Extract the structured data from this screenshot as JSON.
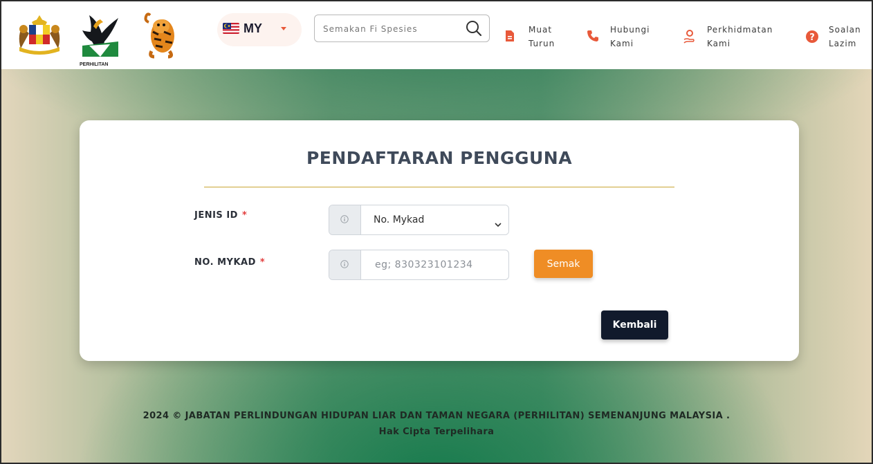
{
  "header": {
    "language": {
      "code": "MY"
    },
    "search": {
      "placeholder": "Semakan Fi Spesies"
    },
    "logos": {
      "perhilitan_label": "PERHILITAN"
    },
    "nav": [
      {
        "label": "Muat\nTurun",
        "icon": "file-download-icon",
        "color": "#e8593a"
      },
      {
        "label": "Hubungi\nKami",
        "icon": "phone-icon",
        "color": "#e8593a"
      },
      {
        "label": "Perkhidmatan\nKami",
        "icon": "service-hand-icon",
        "color": "#e8593a"
      },
      {
        "label": "Soalan\nLazim",
        "icon": "question-circle-icon",
        "color": "#e8593a"
      }
    ]
  },
  "form": {
    "title": "PENDAFTARAN PENGGUNA",
    "jenis_id": {
      "label": "JENIS ID",
      "selected": "No. Mykad"
    },
    "mykad": {
      "label": "NO. MYKAD",
      "placeholder": "eg; 830323101234"
    },
    "required_marker": "*",
    "semak_label": "Semak",
    "kembali_label": "Kembali"
  },
  "footer": {
    "line1": "2024 © JABATAN PERLINDUNGAN HIDUPAN LIAR DAN TAMAN NEGARA (PERHILITAN) SEMENANJUNG MALAYSIA .",
    "line2": "Hak Cipta Terpelihara"
  },
  "colors": {
    "accent": "#ef8d25",
    "dark_button": "#111a2c",
    "divider": "#c9a532",
    "icon": "#e8593a"
  }
}
